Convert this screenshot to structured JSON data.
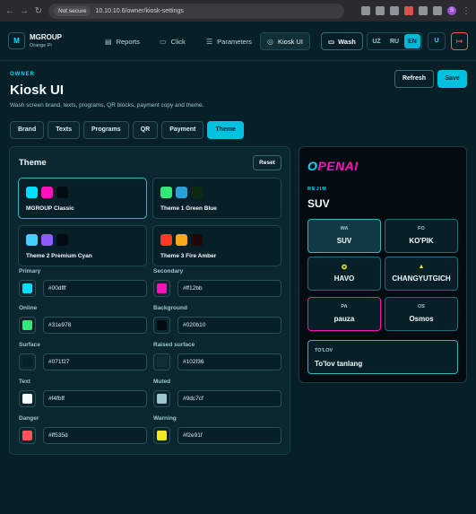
{
  "browser": {
    "security_label": "Not secure",
    "url": "10.10.10.6/owner/kiosk-settings",
    "profile_initial": "S"
  },
  "header": {
    "logo_letter": "M",
    "brand_name": "MGROUP",
    "brand_sub": "Orange Pi",
    "nav": [
      {
        "label": "Reports",
        "icon": "bar-chart-icon"
      },
      {
        "label": "Click",
        "icon": "card-icon"
      },
      {
        "label": "Parameters",
        "icon": "sliders-icon"
      },
      {
        "label": "Kiosk UI",
        "icon": "palette-icon",
        "active": true
      }
    ],
    "wash_label": "Wash",
    "languages": [
      "UZ",
      "RU",
      "EN"
    ],
    "active_language": "EN",
    "user_initial": "U"
  },
  "page": {
    "eyebrow": "OWNER",
    "title": "Kiosk UI",
    "subtitle": "Wash screen brand, texts, programs, QR blocks, payment copy and theme.",
    "refresh_label": "Refresh",
    "save_label": "Save"
  },
  "tabs": [
    {
      "label": "Brand"
    },
    {
      "label": "Texts"
    },
    {
      "label": "Programs"
    },
    {
      "label": "QR"
    },
    {
      "label": "Payment"
    },
    {
      "label": "Theme",
      "active": true
    }
  ],
  "theme": {
    "title": "Theme",
    "reset_label": "Reset",
    "presets": [
      {
        "name": "MGROUP Classic",
        "colors": [
          "#00dfff",
          "#ff12bb",
          "#020b10"
        ],
        "active": true
      },
      {
        "name": "Theme 1 Green Blue",
        "colors": [
          "#31e978",
          "#2aa0d8",
          "#0a2a12"
        ]
      },
      {
        "name": "Theme 2 Premium Cyan",
        "colors": [
          "#3fd2ff",
          "#8c5cff",
          "#020b10"
        ]
      },
      {
        "name": "Theme 3 Fire Amber",
        "colors": [
          "#ff3a1f",
          "#f5a91a",
          "#1f0808"
        ]
      }
    ],
    "fields": [
      {
        "label": "Primary",
        "value": "#00dfff"
      },
      {
        "label": "Secondary",
        "value": "#ff12bb"
      },
      {
        "label": "Online",
        "value": "#31e978"
      },
      {
        "label": "Background",
        "value": "#020b10"
      },
      {
        "label": "Surface",
        "value": "#071f27"
      },
      {
        "label": "Raised surface",
        "value": "#102f36"
      },
      {
        "label": "Text",
        "value": "#f4fbff"
      },
      {
        "label": "Muted",
        "value": "#9dc7cf"
      },
      {
        "label": "Danger",
        "value": "#ff535d"
      },
      {
        "label": "Warning",
        "value": "#f2e91f"
      }
    ]
  },
  "preview": {
    "brand_part1": "O",
    "brand_part2": "PENAI",
    "mode_label": "REJIM",
    "mode_value": "SUV",
    "cards": [
      {
        "code": "WA",
        "name": "SUV",
        "selected": true
      },
      {
        "code": "FO",
        "name": "KO'PIK"
      },
      {
        "code": "",
        "icon": "brush-icon",
        "name": "HAVO"
      },
      {
        "code": "",
        "icon": "wax-icon",
        "name": "CHANGYUTGICH"
      },
      {
        "code": "PA",
        "name": "pauza",
        "pink": true
      },
      {
        "code": "OS",
        "name": "Osmos"
      }
    ],
    "payment_code": "TO'LOV",
    "payment_name": "To'lov tanlang"
  }
}
